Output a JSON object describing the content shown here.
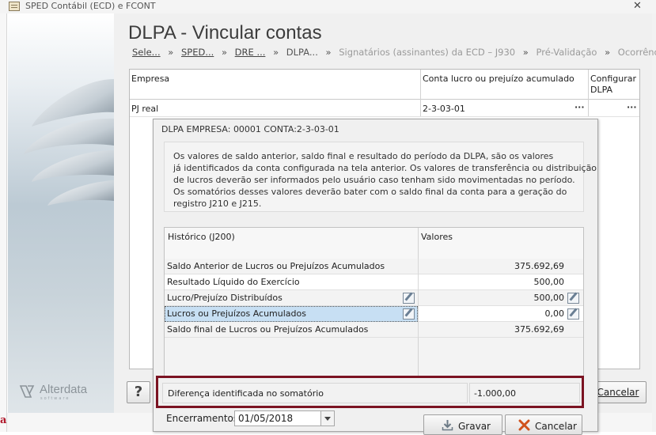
{
  "window": {
    "title": "SPED Contábil (ECD) e FCONT",
    "close_glyph": "✕"
  },
  "brand": {
    "name": "Alterdata",
    "tagline": "software"
  },
  "page_title": "DLPA - Vincular contas",
  "breadcrumb": {
    "items": [
      "Sele...",
      "SPED...",
      "DRE ...",
      "DLPA...",
      "Signatários (assinantes) da ECD – J930",
      "Pré-Validação",
      "Ocorrências"
    ],
    "sep": "»"
  },
  "grid": {
    "columns": [
      "Empresa",
      "Conta lucro ou prejuízo acumulado",
      "Configurar DLPA"
    ],
    "rows": [
      {
        "empresa": "PJ real",
        "conta": "2-3-03-01"
      }
    ],
    "ellipsis": "···"
  },
  "buttons": {
    "help": "?",
    "cancel_outer": "Cancelar",
    "save": "Gravar",
    "cancel": "Cancelar"
  },
  "dialog": {
    "title": "DLPA EMPRESA: 00001 CONTA:2-3-03-01",
    "info_lines": [
      "Os valores de saldo anterior, saldo final e resultado do período da DLPA, são os valores",
      "já identificados da conta configurada na tela anterior. Os valores de transferência ou distribuição",
      "de lucros deverão ser informados pelo usuário caso tenham sido movimentadas no período.",
      "Os somatórios desses valores deverão bater com o saldo final da conta para a geração do",
      "registro J210 e J215."
    ],
    "table": {
      "columns": [
        "Histórico (J200)",
        "Valores"
      ],
      "rows": [
        {
          "historico": "Saldo Anterior de Lucros ou Prejuízos Acumulados",
          "valor": "375.692,69"
        },
        {
          "historico": "Resultado Líquido do Exercício",
          "valor": "500,00"
        },
        {
          "historico": "Lucro/Prejuízo Distribuídos",
          "valor": "500,00"
        },
        {
          "historico": "Lucros ou Prejuízos Acumulados",
          "valor": "0,00"
        },
        {
          "historico": "Saldo final de Lucros ou Prejuízos Acumulados",
          "valor": "375.692,69"
        }
      ]
    },
    "difference": {
      "label": "Diferença identificada no somatório",
      "value": "-1.000,00"
    },
    "encerramentos": {
      "label": "Encerramentos:",
      "value": "01/05/2018"
    }
  },
  "colors": {
    "highlight_row": "#c7dff3",
    "diff_border": "#7b1322",
    "accent_red": "#b0182b"
  },
  "edge_glyph": "a"
}
